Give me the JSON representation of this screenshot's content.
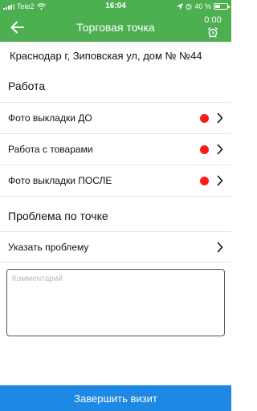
{
  "status_bar": {
    "carrier": "Tele2",
    "time": "16:04",
    "battery_text": "40 %",
    "battery_level": 0.4
  },
  "header": {
    "title": "Торговая точка",
    "timer": "0:00"
  },
  "address": "Краснодар г,  Зиповская ул,  дом № №44",
  "work_section": {
    "title": "Работа",
    "items": [
      {
        "label": "Фото выкладки ДО",
        "status_color": "#ff1a1a"
      },
      {
        "label": "Работа с товарами",
        "status_color": "#ff1a1a"
      },
      {
        "label": "Фото выкладки ПОСЛЕ",
        "status_color": "#ff1a1a"
      }
    ]
  },
  "problem_section": {
    "title": "Проблема по точке",
    "item_label": "Указать проблему"
  },
  "comment": {
    "placeholder": "Комментарий",
    "value": ""
  },
  "finish_button": {
    "label": "Завершить визит"
  },
  "colors": {
    "header": "#4caf50",
    "primary_button": "#1e88e5",
    "status_dot": "#ff1a1a"
  },
  "icons": [
    "signal-icon",
    "wifi-icon",
    "location-arrow-icon",
    "alarm-icon",
    "battery-icon",
    "back-arrow-icon",
    "alarm-clock-icon",
    "chevron-right-icon"
  ]
}
